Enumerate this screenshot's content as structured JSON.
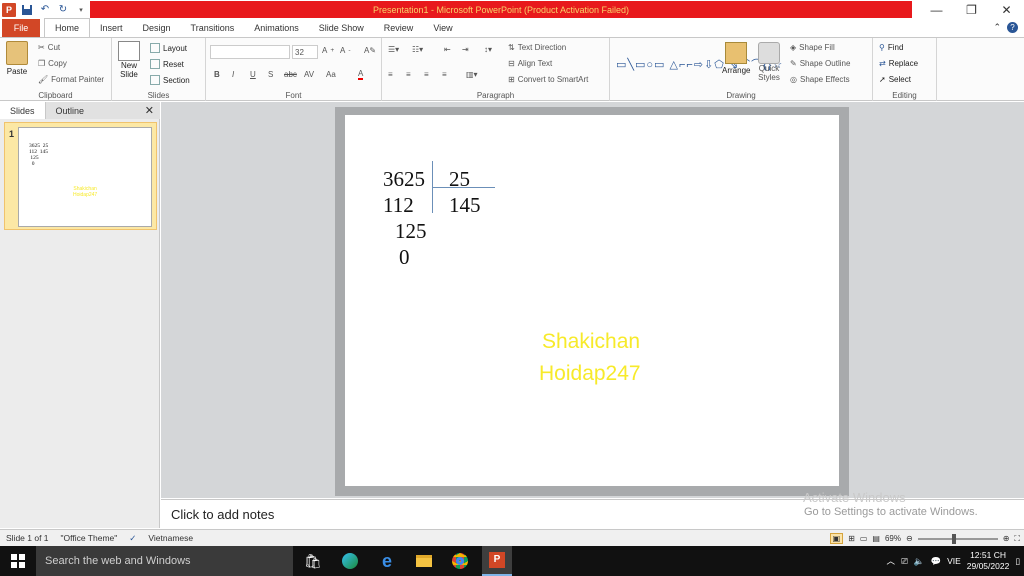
{
  "window": {
    "title": "Presentation1  -  Microsoft PowerPoint (Product Activation Failed)"
  },
  "ribbon_tabs": [
    "File",
    "Home",
    "Insert",
    "Design",
    "Transitions",
    "Animations",
    "Slide Show",
    "Review",
    "View"
  ],
  "clipboard": {
    "paste": "Paste",
    "cut": "Cut",
    "copy": "Copy",
    "format_painter": "Format Painter",
    "label": "Clipboard"
  },
  "slides_group": {
    "new_slide": "New",
    "new_slide2": "Slide",
    "layout": "Layout",
    "reset": "Reset",
    "section": "Section",
    "label": "Slides"
  },
  "font_group": {
    "size": "32",
    "label": "Font",
    "bold": "B",
    "italic": "I",
    "underline": "U",
    "strike": "S",
    "abc": "abc",
    "av": "AV",
    "aa": "Aa",
    "fontcolor": "A"
  },
  "paragraph_group": {
    "text_direction": "Text Direction",
    "align_text": "Align Text",
    "smartart": "Convert to SmartArt",
    "label": "Paragraph"
  },
  "drawing_group": {
    "arrange": "Arrange",
    "quick_styles": "Quick",
    "quick_styles2": "Styles",
    "shape_fill": "Shape Fill",
    "shape_outline": "Shape Outline",
    "shape_effects": "Shape Effects",
    "label": "Drawing"
  },
  "editing_group": {
    "find": "Find",
    "replace": "Replace",
    "select": "Select",
    "label": "Editing"
  },
  "pane": {
    "tab_slides": "Slides",
    "tab_outline": "Outline",
    "slide_number": "1"
  },
  "slide": {
    "dividend": "3625",
    "divisor": "25",
    "remainder1": "112",
    "quotient": "145",
    "step2": "125",
    "final": "0",
    "watermark1": "Shakichan",
    "watermark2": "Hoidap247"
  },
  "notes": {
    "placeholder": "Click to add notes"
  },
  "activation": {
    "line1": "Activate Windows",
    "line2": "Go to Settings to activate Windows."
  },
  "status": {
    "slide": "Slide 1 of 1",
    "theme": "\"Office Theme\"",
    "language": "Vietnamese",
    "zoom": "69%"
  },
  "taskbar": {
    "search": "Search the web and Windows",
    "lang": "VIE",
    "time": "12:51 CH",
    "date": "29/05/2022"
  }
}
